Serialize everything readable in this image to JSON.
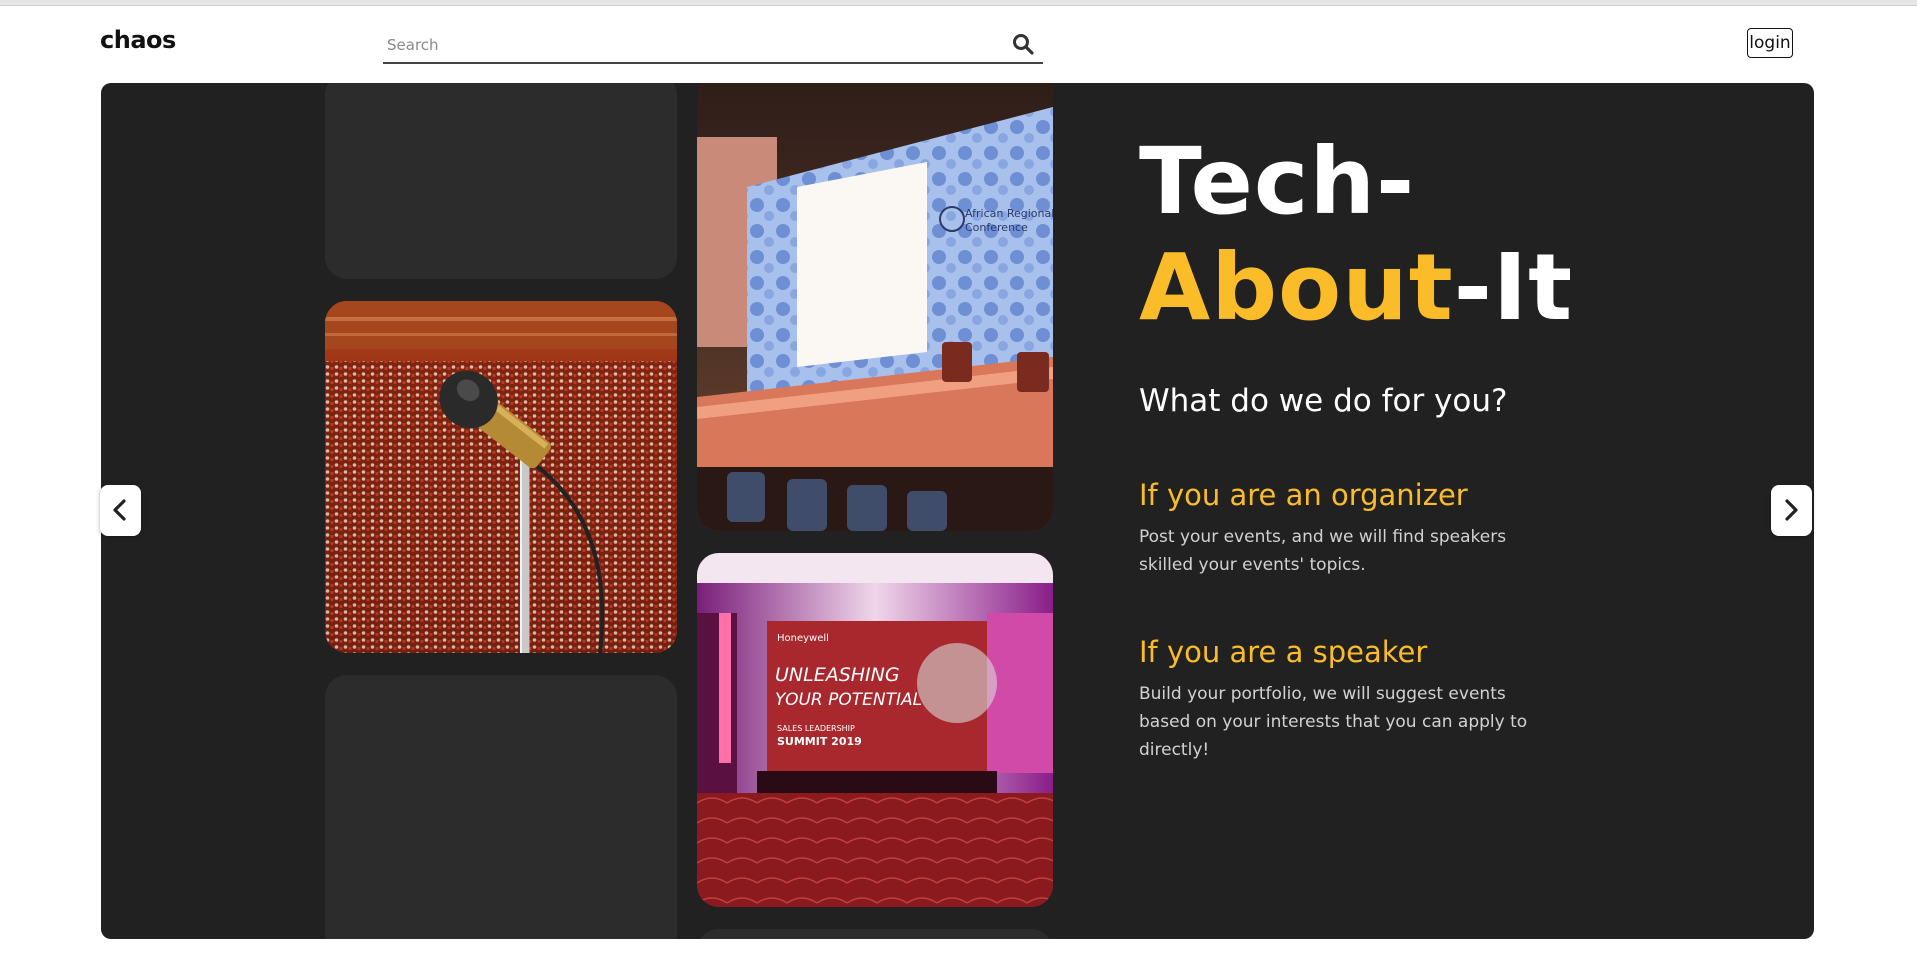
{
  "header": {
    "logo": "chaos",
    "search_placeholder": "Search",
    "login_label": "login"
  },
  "hero": {
    "title_line1": "Tech-",
    "title_accent": "About",
    "title_rest": "-It",
    "subtitle": "What do we do for you?",
    "sections": [
      {
        "heading": "If you are an organizer",
        "text": "Post your events, and we will find speakers skilled your events' topics."
      },
      {
        "heading": "If you are a speaker",
        "text": "Build your portfolio, we will suggest events based on your interests that you can apply to directly!"
      }
    ],
    "images": [
      {
        "kind": "conference-stage",
        "signage_line1": "African Regional",
        "signage_line2": "Conference"
      },
      {
        "kind": "microphone-audience"
      },
      {
        "kind": "event-stage",
        "brand": "Honeywell",
        "banner_line1": "UNLEASHING",
        "banner_line2": "YOUR POTENTIAL",
        "banner_line3": "SALES LEADERSHIP",
        "banner_line4": "SUMMIT 2019"
      }
    ]
  },
  "colors": {
    "accent": "#fbbc2a",
    "hero_bg": "#212121",
    "tile_bg": "#2c2c2c",
    "text_light": "#ffffff",
    "text_muted": "#d2d2d2"
  },
  "icons": {
    "search": "search-icon",
    "prev": "chevron-left-icon",
    "next": "chevron-right-icon"
  }
}
